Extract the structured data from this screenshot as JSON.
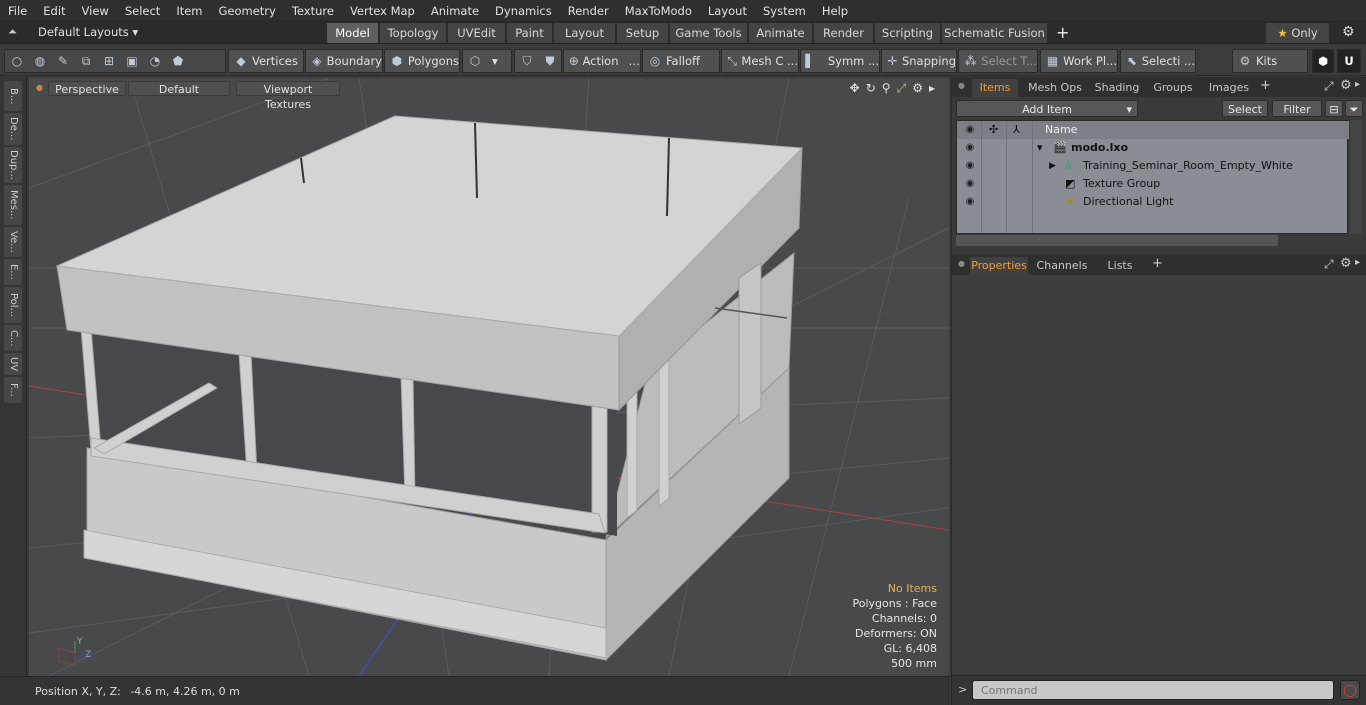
{
  "menu": [
    "File",
    "Edit",
    "View",
    "Select",
    "Item",
    "Geometry",
    "Texture",
    "Vertex Map",
    "Animate",
    "Dynamics",
    "Render",
    "MaxToModo",
    "Layout",
    "System",
    "Help"
  ],
  "layout": {
    "default_layouts": "Default Layouts ▾",
    "tabs": [
      "Model",
      "Topology",
      "UVEdit",
      "Paint",
      "Layout",
      "Setup",
      "Game Tools",
      "Animate",
      "Render",
      "Scripting",
      "Schematic Fusion"
    ],
    "active_tab": "Model",
    "only_label": "Only"
  },
  "toolbar": {
    "vertices": "Vertices",
    "boundary": "Boundary",
    "polygons": "Polygons",
    "action": "Action",
    "falloff": "Falloff",
    "mesh_c": "Mesh C ...",
    "symm": "Symm ...",
    "snapping": "Snapping",
    "select_t": "Select T...",
    "work_pl": "Work Pl...",
    "selecti": "Selecti ...",
    "kits": "Kits"
  },
  "left_tabs": [
    "B...",
    "De...",
    "Dup...",
    "Mes...",
    "Ve...",
    "E...",
    "Pol...",
    "C...",
    "UV",
    "F..."
  ],
  "viewport": {
    "view": "Perspective",
    "shading": "Default",
    "textures": "Viewport Textures",
    "stats": {
      "no_items": "No Items",
      "polygons": "Polygons : Face",
      "channels": "Channels: 0",
      "deformers": "Deformers: ON",
      "gl": "GL: 6,408",
      "unit": "500 mm"
    },
    "axis_y": "Y",
    "axis_z": "Z"
  },
  "status": {
    "label": "Position X, Y, Z:",
    "value": "-4.6 m, 4.26 m, 0 m"
  },
  "items_panel": {
    "tabs": [
      "Items",
      "Mesh Ops",
      "Shading",
      "Groups",
      "Images"
    ],
    "add_item": "Add Item",
    "select": "Select",
    "filter": "Filter",
    "col_name": "Name",
    "rows": [
      "modo.lxo",
      "Training_Seminar_Room_Empty_White",
      "Texture Group",
      "Directional Light"
    ]
  },
  "props_panel": {
    "tabs": [
      "Properties",
      "Channels",
      "Lists"
    ]
  },
  "command": {
    "placeholder": "Command"
  },
  "colors": {
    "accent": "#f0a030",
    "viewport_bg": "#47494b",
    "model": "#d8d8d8"
  }
}
